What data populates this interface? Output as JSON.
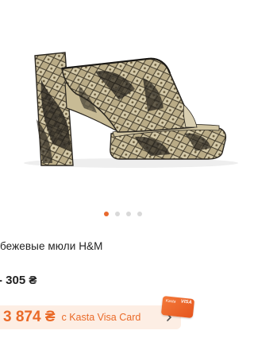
{
  "product": {
    "image_alt": "",
    "gallery": {
      "total": 4,
      "active_index": 0
    },
    "title": "бежевые мюли H&M",
    "old_price": "- 305 ₴"
  },
  "promo": {
    "price": "3 874 ₴",
    "text": "с Kasta Visa Card",
    "badge_brand": "Kasta",
    "badge_network": "VISA"
  },
  "colors": {
    "accent": "#e8692e",
    "promo_bg": "#fdeee4",
    "dot_inactive": "#d9d9d9"
  }
}
